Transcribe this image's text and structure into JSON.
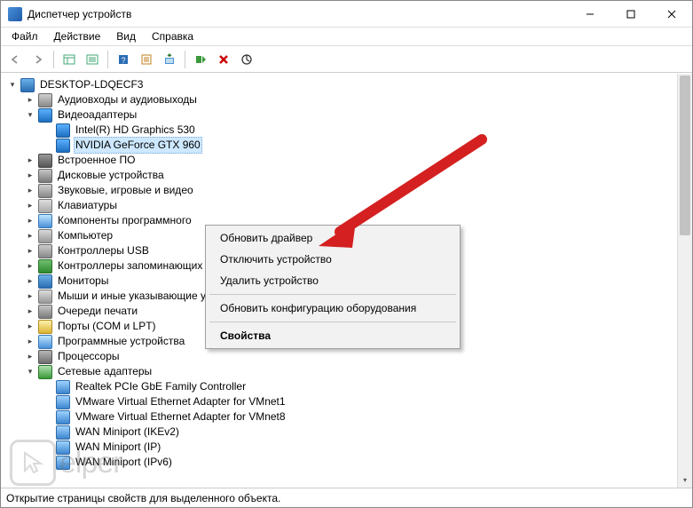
{
  "window": {
    "title": "Диспетчер устройств"
  },
  "menu": {
    "file": "Файл",
    "action": "Действие",
    "view": "Вид",
    "help": "Справка"
  },
  "tree": {
    "root": "DESKTOP-LDQECF3",
    "cat_audio": "Аудиовходы и аудиовыходы",
    "cat_video": "Видеоадаптеры",
    "video_intel": "Intel(R) HD Graphics 530",
    "video_nvidia": "NVIDIA GeForce GTX 960",
    "cat_firmware": "Встроенное ПО",
    "cat_disks": "Дисковые устройства",
    "cat_sound": "Звуковые, игровые и видео",
    "cat_keyboards": "Клавиатуры",
    "cat_software": "Компоненты программного",
    "cat_computer": "Компьютер",
    "cat_usb": "Контроллеры USB",
    "cat_storage": "Контроллеры запоминающих устройств",
    "cat_monitors": "Мониторы",
    "cat_mice": "Мыши и иные указывающие устройства",
    "cat_printq": "Очереди печати",
    "cat_ports": "Порты (COM и LPT)",
    "cat_swdev": "Программные устройства",
    "cat_cpu": "Процессоры",
    "cat_network": "Сетевые адаптеры",
    "net_realtek": "Realtek PCIe GbE Family Controller",
    "net_vm1": "VMware Virtual Ethernet Adapter for VMnet1",
    "net_vm8": "VMware Virtual Ethernet Adapter for VMnet8",
    "net_wan_ike": "WAN Miniport (IKEv2)",
    "net_wan_ip": "WAN Miniport (IP)",
    "net_wan_ipv6": "WAN Miniport (IPv6)"
  },
  "context": {
    "update": "Обновить драйвер",
    "disable": "Отключить устройство",
    "uninstall": "Удалить устройство",
    "scan": "Обновить конфигурацию оборудования",
    "properties": "Свойства"
  },
  "status": {
    "text": "Открытие страницы свойств для выделенного объекта."
  },
  "watermark": {
    "text": "elper"
  }
}
